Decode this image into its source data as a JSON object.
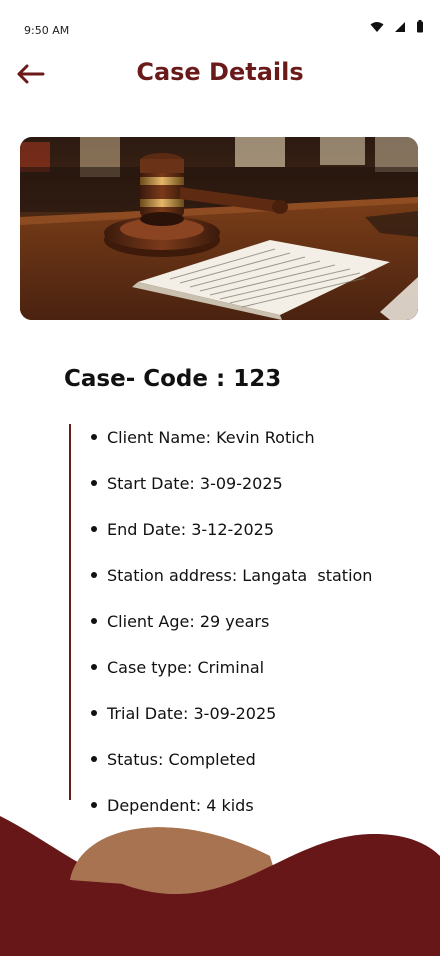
{
  "status_bar": {
    "time": "9:50 AM",
    "icons": [
      "wifi-icon",
      "signal-icon",
      "battery-icon"
    ]
  },
  "header": {
    "title": "Case Details",
    "back_icon": "arrow-left-icon"
  },
  "hero": {
    "image": "gavel-on-desk-with-document"
  },
  "case": {
    "code_label": "Case- Code : 123",
    "details": [
      "Client Name: Kevin Rotich",
      "Start Date: 3-09-2025",
      "End Date: 3-12-2025",
      "Station address: Langata  station",
      "Client Age: 29 years",
      "Case type: Criminal",
      "Trial Date: 3-09-2025",
      "Status: Completed",
      "Dependent: 4 kids"
    ]
  },
  "colors": {
    "accent": "#6b1a1a",
    "wave_primary": "#671717",
    "wave_secondary": "#a87350"
  }
}
